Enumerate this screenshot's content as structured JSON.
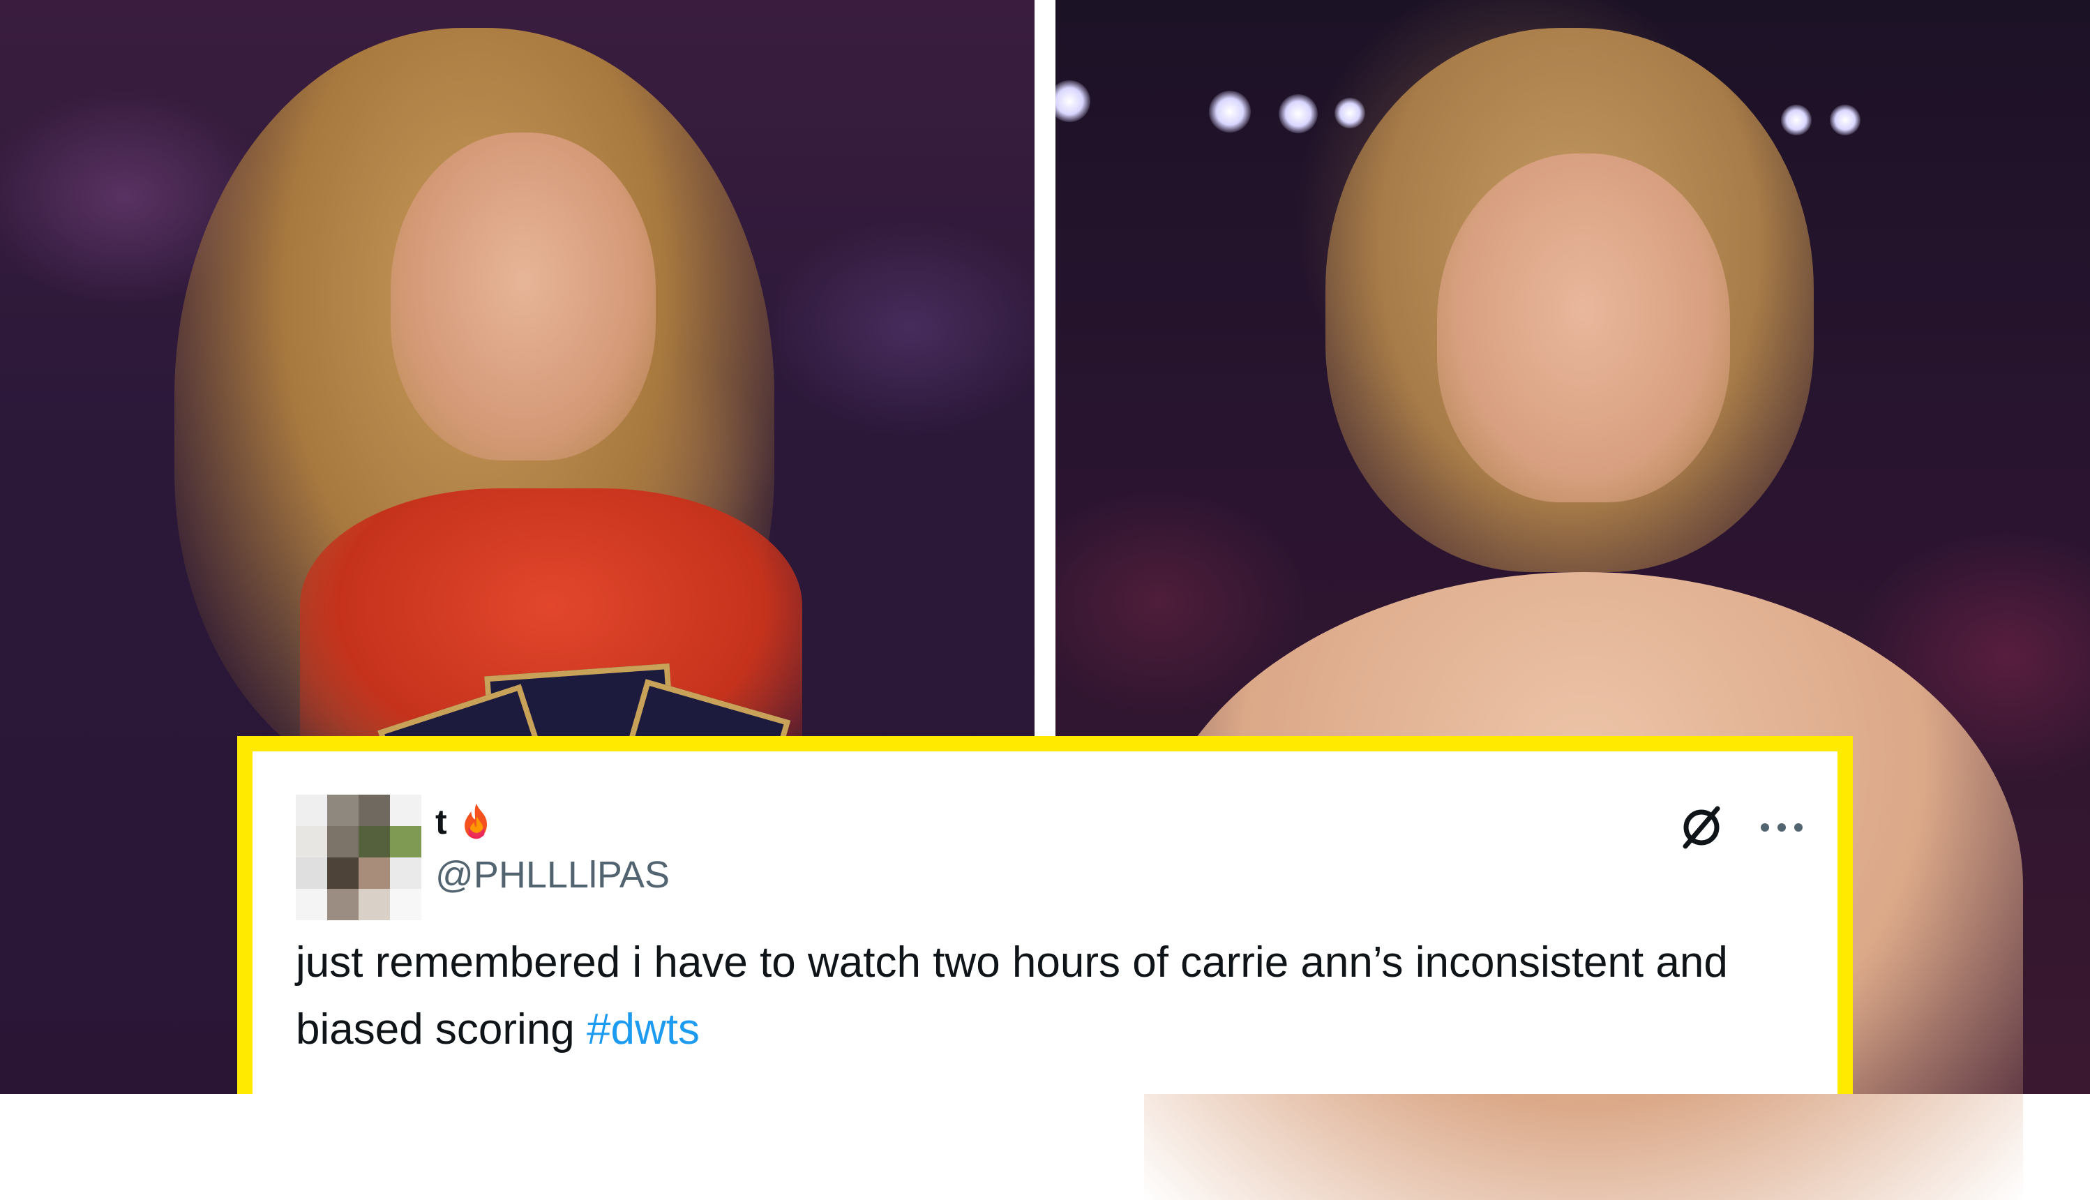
{
  "photos": {
    "left_icon": "left-photo",
    "right_icon": "right-photo"
  },
  "tweet": {
    "display_name": "t",
    "name_emoji": "fire-icon",
    "handle": "@PHLLLlPAS",
    "text_main": "just remembered i have to watch two hours of carrie ann’s inconsistent and biased scoring ",
    "hashtag": "#dwts",
    "brand_icon": "x-logo-icon",
    "menu_icon": "more-icon"
  },
  "colors": {
    "frame": "#ffea00",
    "card": "#ffffff",
    "text": "#0f1419",
    "secondary": "#536471",
    "link": "#1d9bf0"
  }
}
